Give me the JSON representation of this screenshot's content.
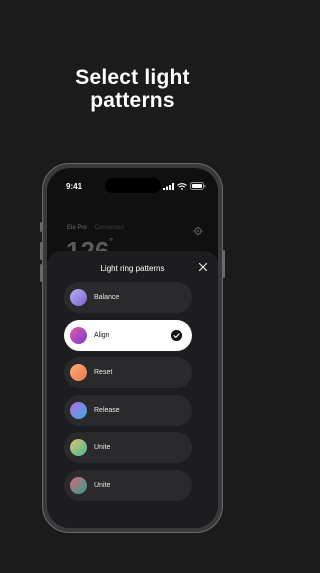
{
  "headline": {
    "line1": "Select light",
    "line2": "patterns"
  },
  "status": {
    "time": "9:41"
  },
  "background_screen": {
    "device": "Ele Pro",
    "subtitle": "Connected",
    "value": "126",
    "unit": "°"
  },
  "sheet": {
    "title": "Light ring patterns",
    "options": [
      {
        "label": "Balance",
        "selected": false,
        "colors": [
          "#b9b2f0",
          "#7d5fd6"
        ]
      },
      {
        "label": "Align",
        "selected": true,
        "colors": [
          "#e05aa8",
          "#7a3bd0"
        ]
      },
      {
        "label": "Reset",
        "selected": false,
        "colors": [
          "#f7b07a",
          "#f0784a"
        ]
      },
      {
        "label": "Release",
        "selected": false,
        "colors": [
          "#c26ad8",
          "#2fb0e8"
        ]
      },
      {
        "label": "Unite",
        "selected": false,
        "colors": [
          "#e3c56b",
          "#45b89a"
        ]
      },
      {
        "label": "Unite",
        "selected": false,
        "colors": [
          "#d86a7a",
          "#2e9d8f"
        ]
      }
    ]
  }
}
